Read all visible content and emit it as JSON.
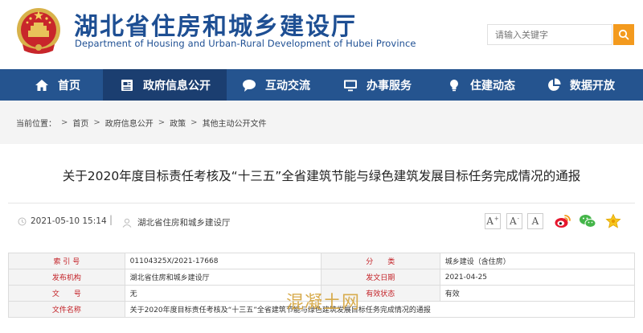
{
  "header": {
    "title_cn": "湖北省住房和城乡建设厅",
    "title_en": "Department of Housing and Urban-Rural Development of Hubei Province",
    "search_placeholder": "请输入关键字"
  },
  "nav": [
    {
      "label": "首页",
      "icon": "home-icon"
    },
    {
      "label": "政府信息公开",
      "icon": "document-icon"
    },
    {
      "label": "互动交流",
      "icon": "chat-icon"
    },
    {
      "label": "办事服务",
      "icon": "monitor-icon"
    },
    {
      "label": "住建动态",
      "icon": "lightbulb-icon"
    },
    {
      "label": "数据开放",
      "icon": "pie-chart-icon"
    }
  ],
  "breadcrumb": {
    "prefix": "当前位置：",
    "items": [
      "首页",
      "政府信息公开",
      "政策",
      "其他主动公开文件"
    ]
  },
  "article": {
    "title": "关于2020年度目标责任考核及“十三五”全省建筑节能与绿色建筑发展目标任务完成情况的通报",
    "date": "2021-05-10 15:14",
    "separator": "|",
    "source": "湖北省住房和城乡建设厅"
  },
  "font_sizes": [
    "A+",
    "A",
    "A"
  ],
  "info": {
    "index_label": "索 引 号",
    "index_value": "01104325X/2021-17668",
    "category_label": "分　　类",
    "category_value": "城乡建设（含住房）",
    "issuer_label": "发布机构",
    "issuer_value": "湖北省住房和城乡建设厅",
    "date_label": "发文日期",
    "date_value": "2021-04-25",
    "docno_label": "文　　号",
    "docno_value": "无",
    "validity_label": "有效状态",
    "validity_value": "有效",
    "filename_label": "文件名称",
    "filename_value": "关于2020年度目标责任考核及“十三五”全省建筑节能与绿色建筑发展目标任务完成情况的通报"
  },
  "watermark": "混凝土网",
  "colors": {
    "brand_blue": "#1e4f93",
    "nav_bg": "#25548f",
    "nav_active": "#1b3e70",
    "search_orange": "#f39a1e",
    "label_red": "#c32026"
  }
}
